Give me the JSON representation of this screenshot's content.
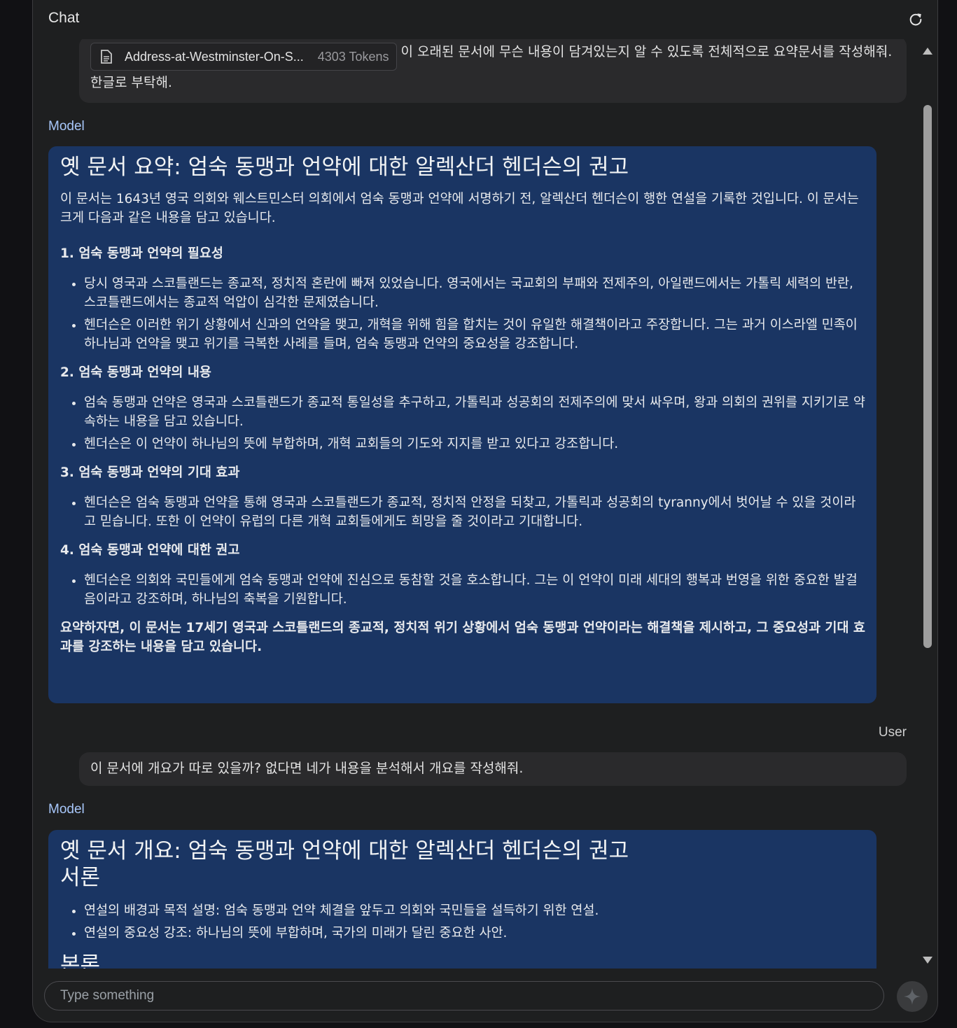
{
  "header": {
    "title": "Chat",
    "refresh_icon": "refresh-icon"
  },
  "messages": {
    "user1": {
      "attachment": {
        "file_name": "Address-at-Westminster-On-S...",
        "tokens": "4303 Tokens",
        "icon": "document-icon"
      },
      "text": "이 오래된 문서에 무슨 내용이 담겨있는지 알 수 있도록 전체적으로 요약문서를 작성해줘. 한글로 부탁해."
    },
    "model1": {
      "role": "Model",
      "title": "옛 문서 요약: 엄숙 동맹과 언약에 대한 알렉산더 헨더슨의 권고",
      "intro": "이 문서는 1643년 영국 의회와 웨스트민스터 의회에서 엄숙 동맹과 언약에 서명하기 전, 알렉산더 헨더슨이 행한 연설을 기록한 것입니다. 이 문서는 크게 다음과 같은 내용을 담고 있습니다.",
      "sections": [
        {
          "heading": "1. 엄숙 동맹과 언약의 필요성",
          "bullets": [
            "당시 영국과 스코틀랜드는 종교적, 정치적 혼란에 빠져 있었습니다. 영국에서는 국교회의 부패와 전제주의, 아일랜드에서는 가톨릭 세력의 반란, 스코틀랜드에서는 종교적 억압이 심각한 문제였습니다.",
            "헨더슨은 이러한 위기 상황에서 신과의 언약을 맺고, 개혁을 위해 힘을 합치는 것이 유일한 해결책이라고 주장합니다. 그는 과거 이스라엘 민족이 하나님과 언약을 맺고 위기를 극복한 사례를 들며, 엄숙 동맹과 언약의 중요성을 강조합니다."
          ]
        },
        {
          "heading": "2. 엄숙 동맹과 언약의 내용",
          "bullets": [
            "엄숙 동맹과 언약은 영국과 스코틀랜드가 종교적 통일성을 추구하고, 가톨릭과 성공회의 전제주의에 맞서 싸우며, 왕과 의회의 권위를 지키기로 약속하는 내용을 담고 있습니다.",
            "헨더슨은 이 언약이 하나님의 뜻에 부합하며, 개혁 교회들의 기도와 지지를 받고 있다고 강조합니다."
          ]
        },
        {
          "heading": "3. 엄숙 동맹과 언약의 기대 효과",
          "bullets": [
            "헨더슨은 엄숙 동맹과 언약을 통해 영국과 스코틀랜드가 종교적, 정치적 안정을 되찾고, 가톨릭과 성공회의 tyranny에서 벗어날 수 있을 것이라고 믿습니다. 또한 이 언약이 유럽의 다른 개혁 교회들에게도 희망을 줄 것이라고 기대합니다."
          ]
        },
        {
          "heading": "4. 엄숙 동맹과 언약에 대한 권고",
          "bullets": [
            "헨더슨은 의회와 국민들에게 엄숙 동맹과 언약에 진심으로 동참할 것을 호소합니다. 그는 이 언약이 미래 세대의 행복과 번영을 위한 중요한 발걸음이라고 강조하며, 하나님의 축복을 기원합니다."
          ]
        }
      ],
      "summary": "요약하자면, 이 문서는 17세기 영국과 스코틀랜드의 종교적, 정치적 위기 상황에서 엄숙 동맹과 언약이라는 해결책을 제시하고, 그 중요성과 기대 효과를 강조하는 내용을 담고 있습니다."
    },
    "user2": {
      "role": "User",
      "text": "이 문서에 개요가 따로 있을까? 없다면 네가 내용을 분석해서 개요를 작성해줘."
    },
    "model2": {
      "role": "Model",
      "title": "옛 문서 개요: 엄숙 동맹과 언약에 대한 알렉산더 헨더슨의 권고",
      "subtitle": "서론",
      "bullets": [
        "연설의 배경과 목적 설명: 엄숙 동맹과 언약 체결을 앞두고 의회와 국민들을 설득하기 위한 연설.",
        "연설의 중요성 강조: 하나님의 뜻에 부합하며, 국가의 미래가 달린 중요한 사안."
      ],
      "next_heading": "본론"
    }
  },
  "input": {
    "placeholder": "Type something",
    "send_icon": "sparkle-icon"
  }
}
